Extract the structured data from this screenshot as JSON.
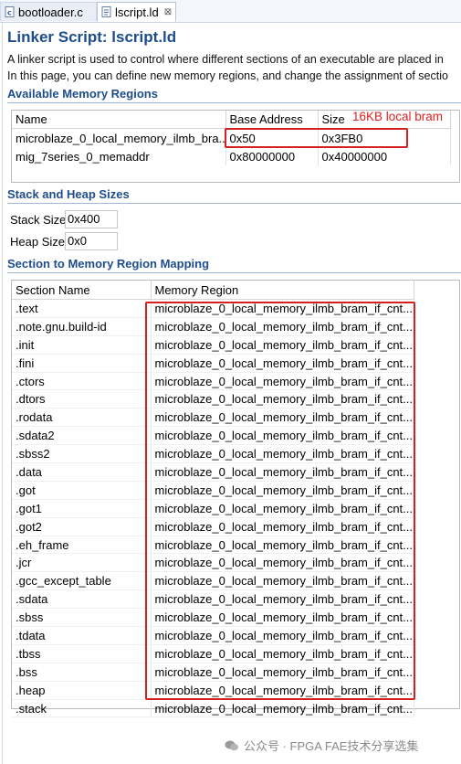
{
  "tabs": [
    {
      "label": "bootloader.c",
      "icon": "c-file-icon"
    },
    {
      "label": "lscript.ld",
      "icon": "linker-file-icon",
      "close": "⊠"
    }
  ],
  "page": {
    "title": "Linker Script: lscript.ld",
    "description_line1": "A linker script is used to control where different sections of an executable are placed in",
    "description_line2": "In this page, you can define new memory regions, and change the assignment of sectio"
  },
  "memory_regions": {
    "heading": "Available Memory Regions",
    "columns": [
      "Name",
      "Base Address",
      "Size"
    ],
    "rows": [
      {
        "name": "microblaze_0_local_memory_ilmb_bra...",
        "base": "0x50",
        "size": "0x3FB0"
      },
      {
        "name": "mig_7series_0_memaddr",
        "base": "0x80000000",
        "size": "0x40000000"
      }
    ],
    "annotation": "16KB local bram"
  },
  "stack_heap": {
    "heading": "Stack and Heap Sizes",
    "stack_label": "Stack Size",
    "stack_value": "0x400",
    "heap_label": "Heap Size",
    "heap_value": "0x0"
  },
  "section_mapping": {
    "heading": "Section to Memory Region Mapping",
    "columns": [
      "Section Name",
      "Memory Region"
    ],
    "region": "microblaze_0_local_memory_ilmb_bram_if_cnt...",
    "sections": [
      ".text",
      ".note.gnu.build-id",
      ".init",
      ".fini",
      ".ctors",
      ".dtors",
      ".rodata",
      ".sdata2",
      ".sbss2",
      ".data",
      ".got",
      ".got1",
      ".got2",
      ".eh_frame",
      ".jcr",
      ".gcc_except_table",
      ".sdata",
      ".sbss",
      ".tdata",
      ".tbss",
      ".bss",
      ".heap",
      ".stack"
    ]
  },
  "watermark": "公众号 · FPGA FAE技术分享选集",
  "colors": {
    "heading": "#1e4d8c",
    "highlight": "#d42020"
  }
}
